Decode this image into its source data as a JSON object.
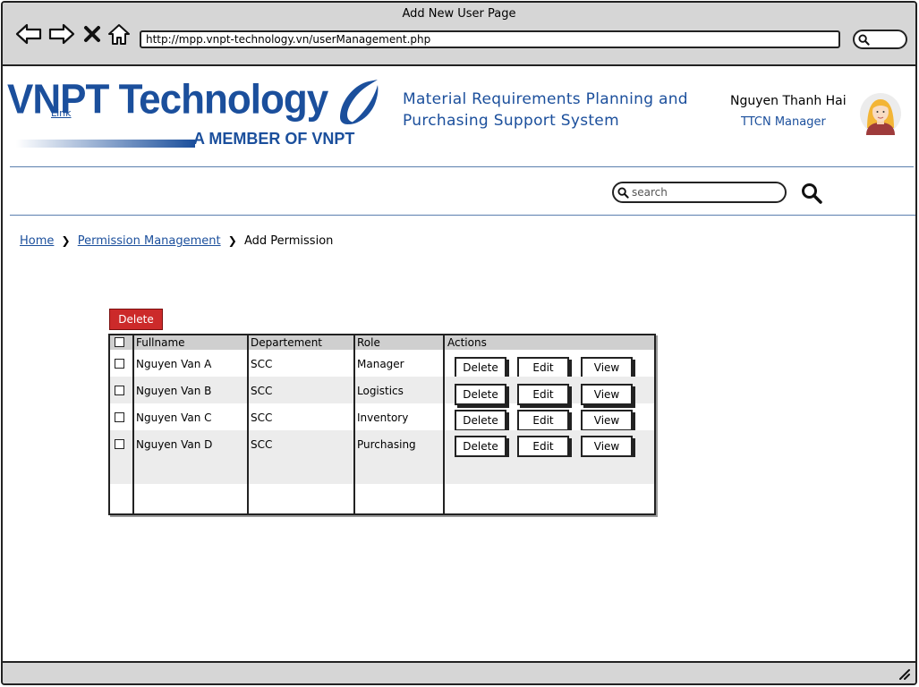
{
  "window": {
    "title": "Add New User Page",
    "url": "http://mpp.vnpt-technology.vn/userManagement.php"
  },
  "icons": {
    "back": "arrow-left-icon",
    "forward": "arrow-right-icon",
    "close": "x-icon",
    "home": "home-icon",
    "search": "magnifier-icon"
  },
  "header": {
    "logo_text": "VNPT Technology",
    "logo_subtitle": "A MEMBER OF VNPT",
    "logo_link": "Link",
    "app_title_line1": "Material Requirements Planning and",
    "app_title_line2": "Purchasing Support System",
    "user_name": "Nguyen Thanh Hai",
    "user_role": "TTCN Manager"
  },
  "search": {
    "placeholder": "search",
    "value": ""
  },
  "breadcrumb": {
    "items": [
      "Home",
      "Permission Management",
      "Add Permission"
    ]
  },
  "toolbar": {
    "delete_label": "Delete"
  },
  "table": {
    "columns": [
      "Fullname",
      "Departement",
      "Role",
      "Actions"
    ],
    "rows": [
      {
        "fullname": "Nguyen Van A",
        "department": "SCC",
        "role": "Manager"
      },
      {
        "fullname": "Nguyen Van B",
        "department": "SCC",
        "role": "Logistics"
      },
      {
        "fullname": "Nguyen Van C",
        "department": "SCC",
        "role": "Inventory"
      },
      {
        "fullname": "Nguyen Van D",
        "department": "SCC",
        "role": "Purchasing"
      }
    ],
    "actions": {
      "delete": "Delete",
      "edit": "Edit",
      "view": "View"
    }
  },
  "colors": {
    "brand_blue": "#1b4f9c",
    "delete_red": "#cc2a2a",
    "chrome_gray": "#d6d6d6"
  }
}
